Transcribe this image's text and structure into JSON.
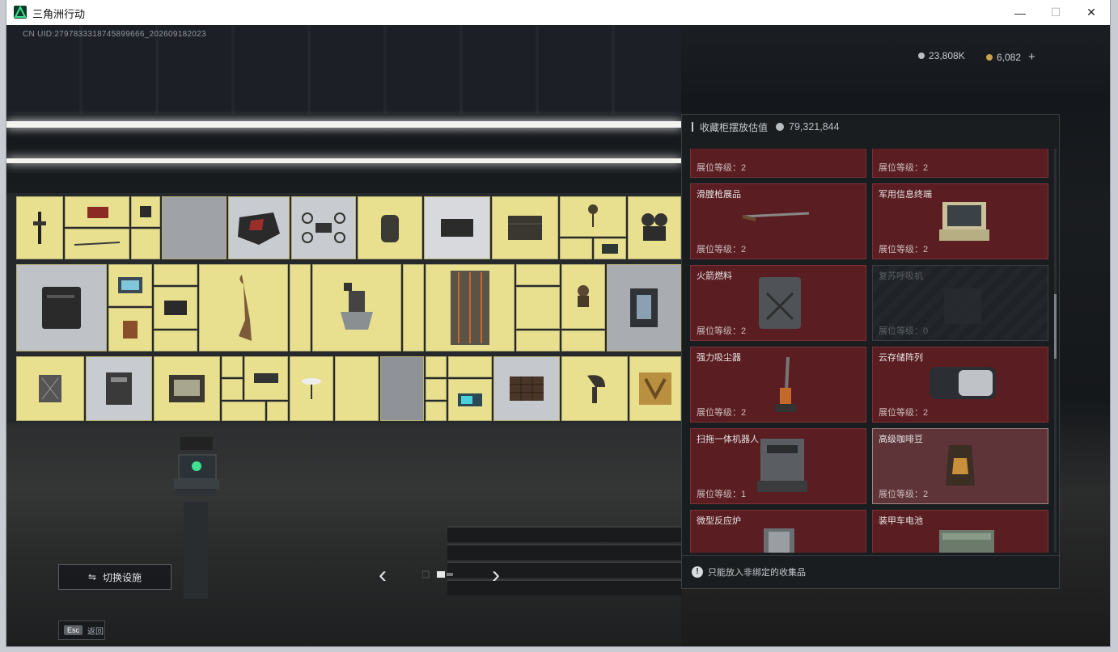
{
  "window": {
    "title": "三角洲行动",
    "minimize": "—",
    "maximize": "☐",
    "close": "✕"
  },
  "hud": {
    "uid": "CN UID:2797833318745899666_202609182023",
    "currency1": "23,808K",
    "currency2": "6,082",
    "add": "+",
    "colors": {
      "silver": "#b9bec3",
      "gold": "#c9a24a"
    }
  },
  "panel": {
    "title": "收藏柜摆放估值",
    "value": "79,321,844",
    "footer": "只能放入非绑定的收集品",
    "items": [
      {
        "name": "",
        "level": "展位等级：2",
        "state": "normal"
      },
      {
        "name": "",
        "level": "展位等级：2",
        "state": "normal"
      },
      {
        "name": "滑膛枪展品",
        "level": "展位等级：2",
        "state": "normal"
      },
      {
        "name": "军用信息终端",
        "level": "展位等级：2",
        "state": "normal"
      },
      {
        "name": "火箭燃料",
        "level": "展位等级：2",
        "state": "normal"
      },
      {
        "name": "复苏呼吸机",
        "level": "展位等级：0",
        "state": "locked"
      },
      {
        "name": "强力吸尘器",
        "level": "展位等级：2",
        "state": "normal"
      },
      {
        "name": "云存储阵列",
        "level": "展位等级：2",
        "state": "normal"
      },
      {
        "name": "扫拖一体机器人",
        "level": "展位等级：1",
        "state": "normal"
      },
      {
        "name": "高级咖啡豆",
        "level": "展位等级：2",
        "state": "selected"
      },
      {
        "name": "微型反应炉",
        "level": "",
        "state": "normal"
      },
      {
        "name": "装甲车电池",
        "level": "",
        "state": "normal"
      }
    ],
    "colors": {
      "item_bg": "#5a1e22",
      "item_border": "#7d3136",
      "selected_bg": "#5e3438"
    }
  },
  "controls": {
    "switch": "切换设施",
    "esc_key": "Esc",
    "esc_label": "返回",
    "prev": "‹",
    "next": "›"
  }
}
